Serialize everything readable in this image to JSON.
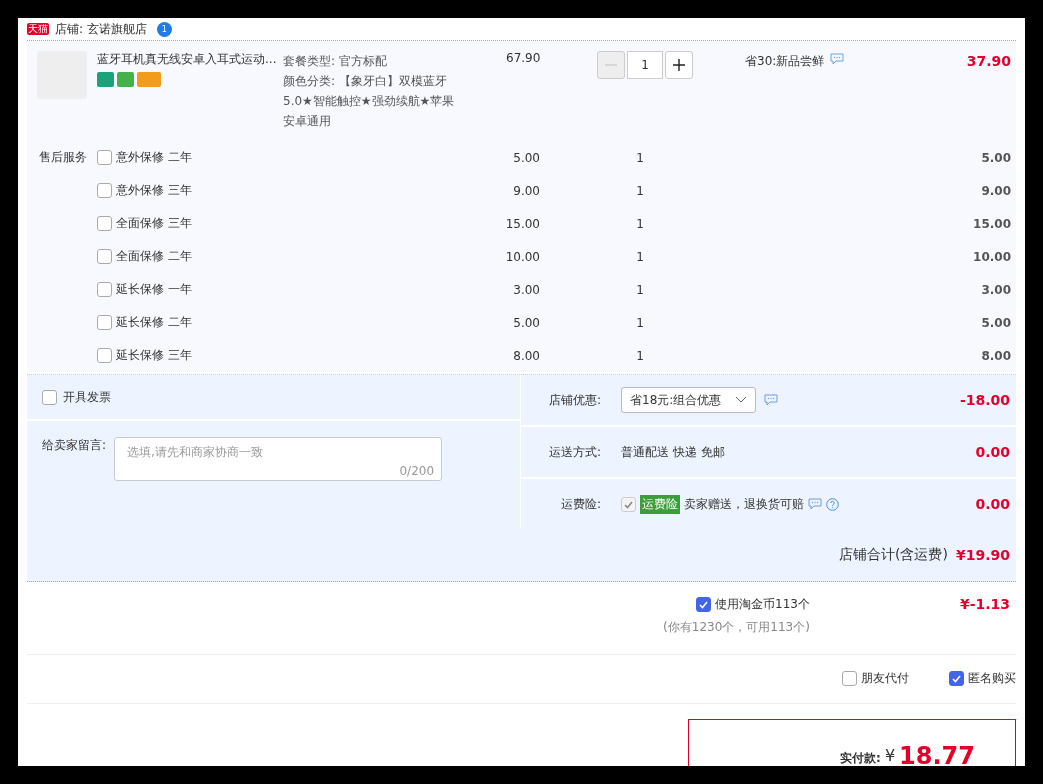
{
  "store": {
    "logo": "天猫",
    "name": "店铺: 玄诺旗舰店",
    "badge": "1"
  },
  "product": {
    "title": "蓝牙耳机真无线安卓入耳式运动...",
    "specs": [
      "套餐类型: 官方标配",
      "颜色分类: 【象牙白】双模蓝牙5.0★智能触控★强劲续航★苹果安卓通用"
    ],
    "price": "67.90",
    "quantity": "1",
    "minus_disabled": true,
    "promo": "省30:新品尝鲜",
    "total": "37.90"
  },
  "services": {
    "label": "售后服务",
    "items": [
      {
        "name": "意外保修 二年",
        "price": "5.00",
        "qty": "1",
        "total": "5.00",
        "checked": false
      },
      {
        "name": "意外保修 三年",
        "price": "9.00",
        "qty": "1",
        "total": "9.00",
        "checked": false
      },
      {
        "name": "全面保修 三年",
        "price": "15.00",
        "qty": "1",
        "total": "15.00",
        "checked": false
      },
      {
        "name": "全面保修 二年",
        "price": "10.00",
        "qty": "1",
        "total": "10.00",
        "checked": false
      },
      {
        "name": "延长保修 一年",
        "price": "3.00",
        "qty": "1",
        "total": "3.00",
        "checked": false
      },
      {
        "name": "延长保修 二年",
        "price": "5.00",
        "qty": "1",
        "total": "5.00",
        "checked": false
      },
      {
        "name": "延长保修 三年",
        "price": "8.00",
        "qty": "1",
        "total": "8.00",
        "checked": false
      }
    ]
  },
  "invoice": {
    "label": "开具发票",
    "checked": false
  },
  "message": {
    "label": "给卖家留言:",
    "placeholder": "选填,请先和商家协商一致",
    "counter": "0/200"
  },
  "discount": {
    "label": "店铺优惠:",
    "value": "省18元:组合优惠",
    "amount": "-18.00"
  },
  "shipping": {
    "label": "运送方式:",
    "value": "普通配送 快递 免邮",
    "amount": "0.00"
  },
  "insurance": {
    "label": "运费险:",
    "checked": true,
    "disabled": true,
    "tag": "运费险",
    "text": "卖家赠送，退换货可赔",
    "amount": "0.00"
  },
  "subtotal": {
    "label": "店铺合计(含运费)",
    "amount": "¥19.90"
  },
  "coins": {
    "label": "使用淘金币113个",
    "checked": true,
    "note": "(你有1230个，可用113个)",
    "amount": "¥-1.13"
  },
  "options": [
    {
      "label": "朋友代付",
      "checked": false
    },
    {
      "label": "匿名购买",
      "checked": true
    }
  ],
  "payment": {
    "label": "实付款:",
    "currency": "¥",
    "amount": "18.77"
  }
}
